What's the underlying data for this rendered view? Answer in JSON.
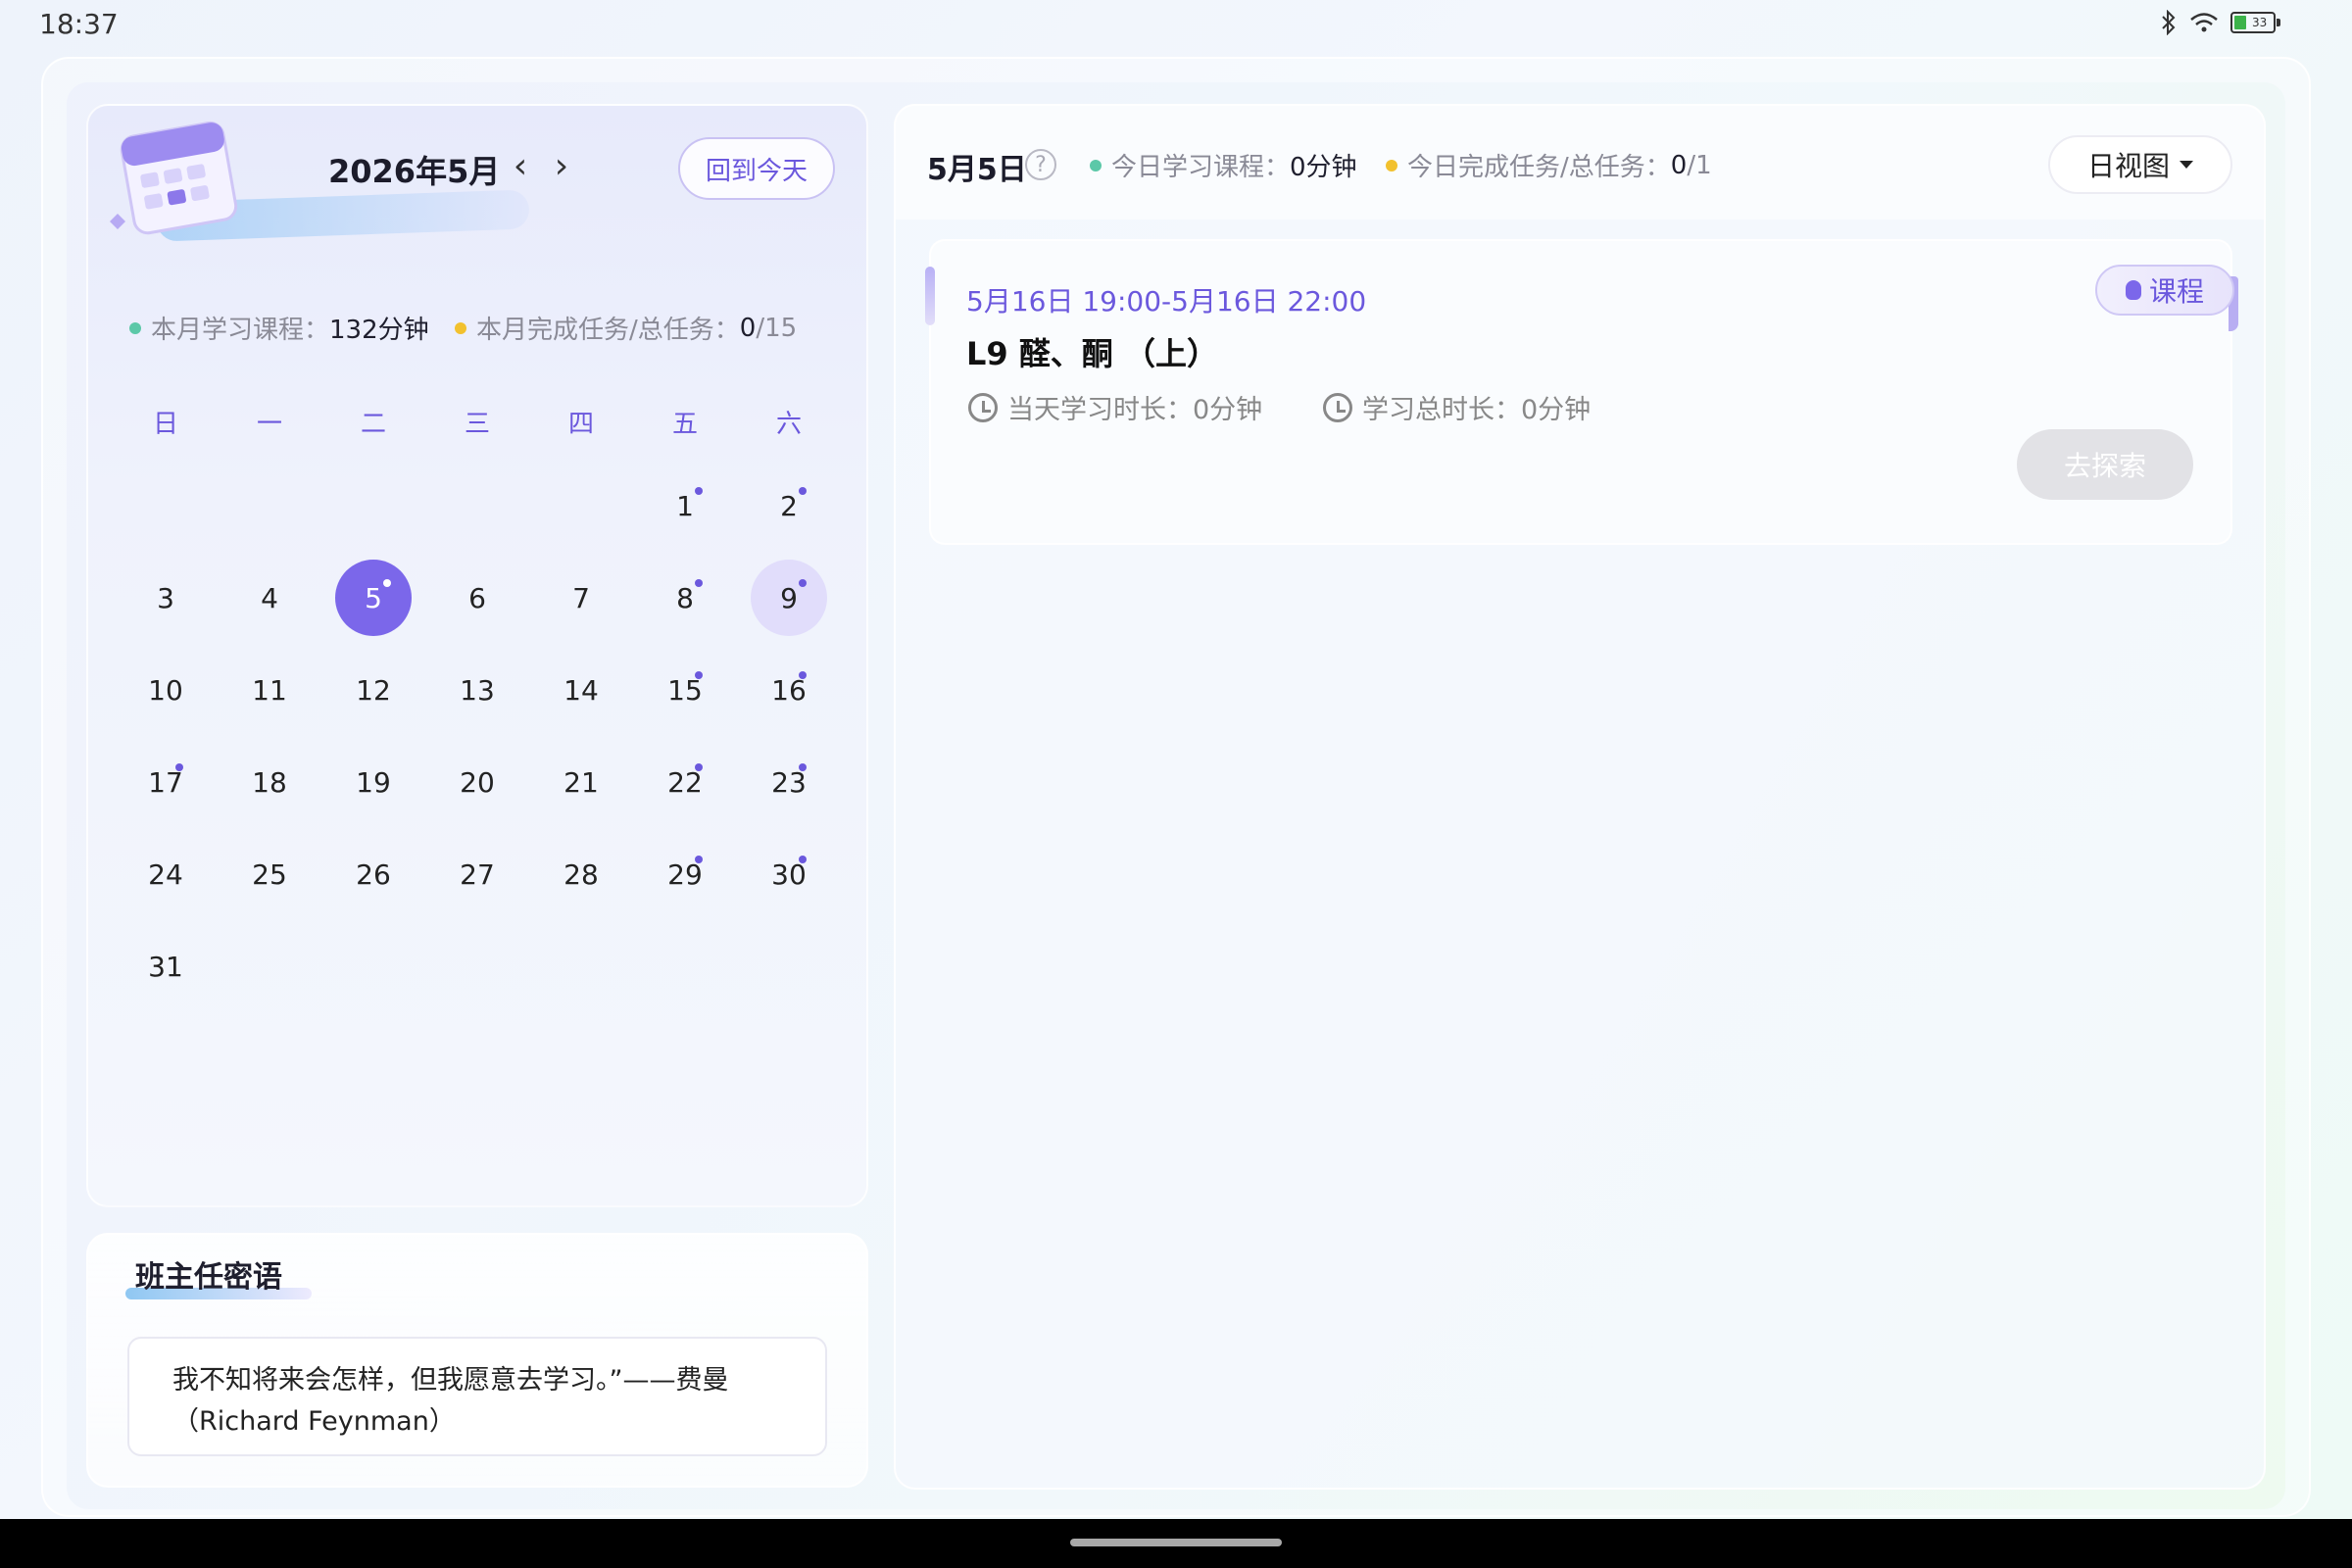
{
  "status_bar": {
    "time": "18:37",
    "battery": "33"
  },
  "calendar": {
    "month_title": "2026年5月",
    "prev_icon": "‹",
    "next_icon": "›",
    "today_button": "回到今天",
    "stats": {
      "course_label": "本月学习课程：",
      "course_value": "132分钟",
      "task_label": "本月完成任务/总任务：",
      "task_done": "0",
      "task_total": "/15",
      "course_color": "#5cc8a8",
      "task_color": "#f2c12e"
    },
    "weekdays": [
      "日",
      "一",
      "二",
      "三",
      "四",
      "五",
      "六"
    ],
    "days": [
      "1",
      "2",
      "3",
      "4",
      "5",
      "6",
      "7",
      "8",
      "9",
      "10",
      "11",
      "12",
      "13",
      "14",
      "15",
      "16",
      "17",
      "18",
      "19",
      "20",
      "21",
      "22",
      "23",
      "24",
      "25",
      "26",
      "27",
      "28",
      "29",
      "30",
      "31"
    ],
    "today": "5",
    "selected": "9",
    "marked_days": [
      "1",
      "2",
      "5",
      "8",
      "9",
      "15",
      "16",
      "17",
      "22",
      "23",
      "29",
      "30"
    ],
    "accent_color": "#7b67ea"
  },
  "motto": {
    "title": "班主任密语",
    "line1": "我不知将来会怎样，但我愿意去学习。”——费曼",
    "line2": "（Richard Feynman）"
  },
  "day_view": {
    "date": "5月5日",
    "help_icon": "?",
    "course_label": "今日学习课程：",
    "course_value": "0分钟",
    "task_label": "今日完成任务/总任务：",
    "task_done": "0",
    "task_total": "/1",
    "view_button": "日视图"
  },
  "task": {
    "time": "5月16日 19:00-5月16日 22:00",
    "title": "L9 醛、酮 （上）",
    "today_duration_label": "当天学习时长：0分钟",
    "total_duration_label": "学习总时长：0分钟",
    "tag": "课程",
    "button": "去探索"
  }
}
